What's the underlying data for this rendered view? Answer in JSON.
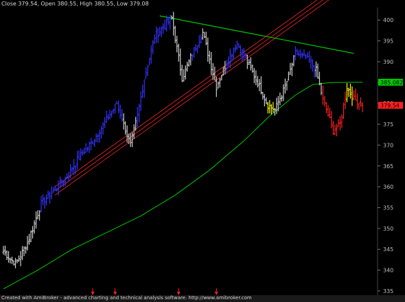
{
  "header": {
    "text": "Close 379.54, Open 380.55, High 380.55, Low 379.08"
  },
  "footer": {
    "text": "Created with AmiBroker - advanced charting and technical analysis software. http://www.amibroker.com"
  },
  "colors": {
    "background": "#000000",
    "up_trend": "#3333ff",
    "neutral": "#d0d0d0",
    "down_trend": "#ff2020",
    "caution": "#ffff00",
    "moving_average": "#00cc00",
    "trendline": "#00cc00",
    "channel": "#cc2222",
    "arrow": "#ff2020",
    "axis_text": "#bfbfbf"
  },
  "chart_data": {
    "type": "ohlc",
    "ylim": [
      334,
      403
    ],
    "y_ticks": [
      335,
      340,
      345,
      350,
      355,
      360,
      365,
      370,
      375,
      380,
      385,
      390,
      395,
      400
    ],
    "y_tick_labels": [
      "335",
      "340",
      "345",
      "350",
      "355",
      "360",
      "365",
      "370",
      "375",
      "380",
      "385",
      "390",
      "395",
      "400"
    ],
    "price_tags": [
      {
        "label": "385.082",
        "value": 385.08,
        "color": "#00cc00",
        "text_color": "#000000"
      },
      {
        "label": "379.54",
        "value": 379.54,
        "color": "#ff2020",
        "text_color": "#000000"
      }
    ],
    "bar_count": 210,
    "segments": [
      {
        "from": 0,
        "to": 7,
        "start": 344.5,
        "end": 341.5,
        "color": "#d0d0d0"
      },
      {
        "from": 7,
        "to": 14,
        "start": 341.5,
        "end": 346.5,
        "color": "#d0d0d0"
      },
      {
        "from": 14,
        "to": 22,
        "start": 346.5,
        "end": 356,
        "color": "#d0d0d0"
      },
      {
        "from": 22,
        "to": 36,
        "start": 356,
        "end": 362,
        "color": "#3333ff"
      },
      {
        "from": 36,
        "to": 44,
        "start": 362,
        "end": 367,
        "color": "#3333ff"
      },
      {
        "from": 44,
        "to": 52,
        "start": 367,
        "end": 371,
        "color": "#3333ff"
      },
      {
        "from": 52,
        "to": 60,
        "start": 371,
        "end": 376,
        "color": "#3333ff"
      },
      {
        "from": 60,
        "to": 66,
        "start": 376,
        "end": 380,
        "color": "#3333ff"
      },
      {
        "from": 66,
        "to": 70,
        "start": 380,
        "end": 375,
        "color": "#3333ff"
      },
      {
        "from": 70,
        "to": 74,
        "start": 375,
        "end": 370,
        "color": "#d0d0d0"
      },
      {
        "from": 74,
        "to": 78,
        "start": 370,
        "end": 377,
        "color": "#d0d0d0"
      },
      {
        "from": 78,
        "to": 82,
        "start": 377,
        "end": 386,
        "color": "#3333ff"
      },
      {
        "from": 82,
        "to": 88,
        "start": 386,
        "end": 396,
        "color": "#3333ff"
      },
      {
        "from": 88,
        "to": 98,
        "start": 396,
        "end": 400.5,
        "color": "#3333ff"
      },
      {
        "from": 98,
        "to": 104,
        "start": 400.5,
        "end": 386,
        "color": "#d0d0d0"
      },
      {
        "from": 104,
        "to": 110,
        "start": 386,
        "end": 392,
        "color": "#d0d0d0"
      },
      {
        "from": 110,
        "to": 116,
        "start": 392,
        "end": 397,
        "color": "#3333ff"
      },
      {
        "from": 116,
        "to": 124,
        "start": 397,
        "end": 384,
        "color": "#d0d0d0"
      },
      {
        "from": 124,
        "to": 130,
        "start": 384,
        "end": 390,
        "color": "#d0d0d0"
      },
      {
        "from": 130,
        "to": 136,
        "start": 390,
        "end": 394.5,
        "color": "#3333ff"
      },
      {
        "from": 136,
        "to": 142,
        "start": 394.5,
        "end": 390,
        "color": "#3333ff"
      },
      {
        "from": 142,
        "to": 148,
        "start": 390,
        "end": 385,
        "color": "#d0d0d0"
      },
      {
        "from": 148,
        "to": 154,
        "start": 385,
        "end": 379.5,
        "color": "#d0d0d0"
      },
      {
        "from": 154,
        "to": 158,
        "start": 379.5,
        "end": 378.5,
        "color": "#ffff00"
      },
      {
        "from": 158,
        "to": 164,
        "start": 378.5,
        "end": 384,
        "color": "#d0d0d0"
      },
      {
        "from": 164,
        "to": 170,
        "start": 384,
        "end": 392,
        "color": "#d0d0d0"
      },
      {
        "from": 170,
        "to": 176,
        "start": 392,
        "end": 391,
        "color": "#3333ff"
      },
      {
        "from": 176,
        "to": 182,
        "start": 391,
        "end": 388,
        "color": "#3333ff"
      },
      {
        "from": 182,
        "to": 186,
        "start": 388,
        "end": 381,
        "color": "#d0d0d0"
      },
      {
        "from": 186,
        "to": 192,
        "start": 381,
        "end": 373.5,
        "color": "#ff2020"
      },
      {
        "from": 192,
        "to": 196,
        "start": 373.5,
        "end": 375,
        "color": "#ff2020"
      },
      {
        "from": 196,
        "to": 200,
        "start": 375,
        "end": 384,
        "color": "#ff2020"
      },
      {
        "from": 200,
        "to": 204,
        "start": 384,
        "end": 381,
        "color": "#ffff00"
      },
      {
        "from": 204,
        "to": 210,
        "start": 381,
        "end": 379.54,
        "color": "#ff2020"
      }
    ],
    "moving_average": [
      {
        "bar": 0,
        "value": 335.5
      },
      {
        "bar": 20,
        "value": 340
      },
      {
        "bar": 40,
        "value": 345
      },
      {
        "bar": 60,
        "value": 349
      },
      {
        "bar": 80,
        "value": 353
      },
      {
        "bar": 100,
        "value": 358
      },
      {
        "bar": 120,
        "value": 364
      },
      {
        "bar": 140,
        "value": 371
      },
      {
        "bar": 155,
        "value": 377
      },
      {
        "bar": 170,
        "value": 382
      },
      {
        "bar": 180,
        "value": 384.5
      },
      {
        "bar": 190,
        "value": 385
      },
      {
        "bar": 209,
        "value": 385.1
      }
    ],
    "trendline": {
      "bar_start": 91,
      "value_start": 401,
      "bar_end": 204,
      "value_end": 392
    },
    "channel_lines": [
      {
        "bar_start": 30,
        "value_start": 360,
        "bar_end": 190,
        "value_end": 407
      },
      {
        "bar_start": 30,
        "value_start": 359,
        "bar_end": 190,
        "value_end": 406
      },
      {
        "bar_start": 30,
        "value_start": 358,
        "bar_end": 190,
        "value_end": 405
      }
    ],
    "signal_arrows": [
      52,
      65,
      102,
      124
    ]
  }
}
